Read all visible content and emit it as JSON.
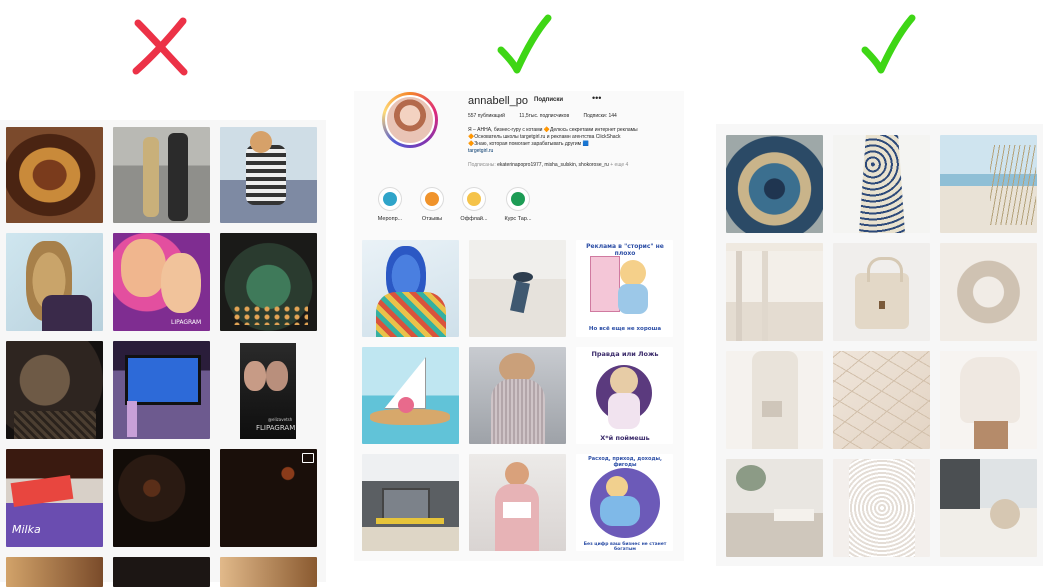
{
  "verdicts": [
    {
      "symbol": "✗",
      "meaning": "bad-example",
      "color": "#ec3247"
    },
    {
      "symbol": "✓",
      "meaning": "good-example",
      "color": "#3ed615"
    },
    {
      "symbol": "✓",
      "meaning": "good-example",
      "color": "#3ed615"
    }
  ],
  "profile": {
    "username": "annabell_po",
    "follow_label": "Подписки",
    "more_label": "•••",
    "stats": {
      "posts": "557 публикаций",
      "followers": "11,5тыс. подписчиков",
      "following": "Подписки: 144"
    },
    "bio": {
      "line1": "Я – АННА, бизнес-гуру с котами 🔶Делюсь секретами интернет рекламы",
      "line2": "🔶Основатель школы targetgirl.ru и рекламн агентства ClickShack",
      "line3": "🔶Знаю, которая помогает зарабатывать другим 🟦",
      "link": "targetgirl.ru"
    },
    "followed_by_label": "Подписаны:",
    "followed_by_names": "ekaterinapopro1977, misha_sulskin, shokorose_ru",
    "followed_by_more": "+ еще 4",
    "highlights": [
      {
        "label": "Меропр...",
        "icon": "event-highlight-icon",
        "color": "#2fa4c9"
      },
      {
        "label": "Отзывы",
        "icon": "reviews-highlight-icon",
        "color": "#f0932b"
      },
      {
        "label": "Оффлай...",
        "icon": "offline-highlight-icon",
        "color": "#f5c34a"
      },
      {
        "label": "Курс Тар...",
        "icon": "course-highlight-icon",
        "color": "#1d9c55"
      }
    ]
  },
  "post_texts": {
    "ad_title": "Реклама в \"сторис\" не плохо",
    "ad_caption": "Но всё еще не хороша",
    "truth_title": "Правда или Ложь",
    "truth_caption": "Х*й поймешь",
    "money_title": "Расход, приход, доходы, фигоды",
    "money_caption": "Без цифр ваш бизнес не станет богатым",
    "tiktok_tag": "FLIPAGRAM",
    "tiktok_user": "@elizavetsh",
    "bad_photo_tag": "LIPAGRAM",
    "snack_brand": "Milka"
  }
}
